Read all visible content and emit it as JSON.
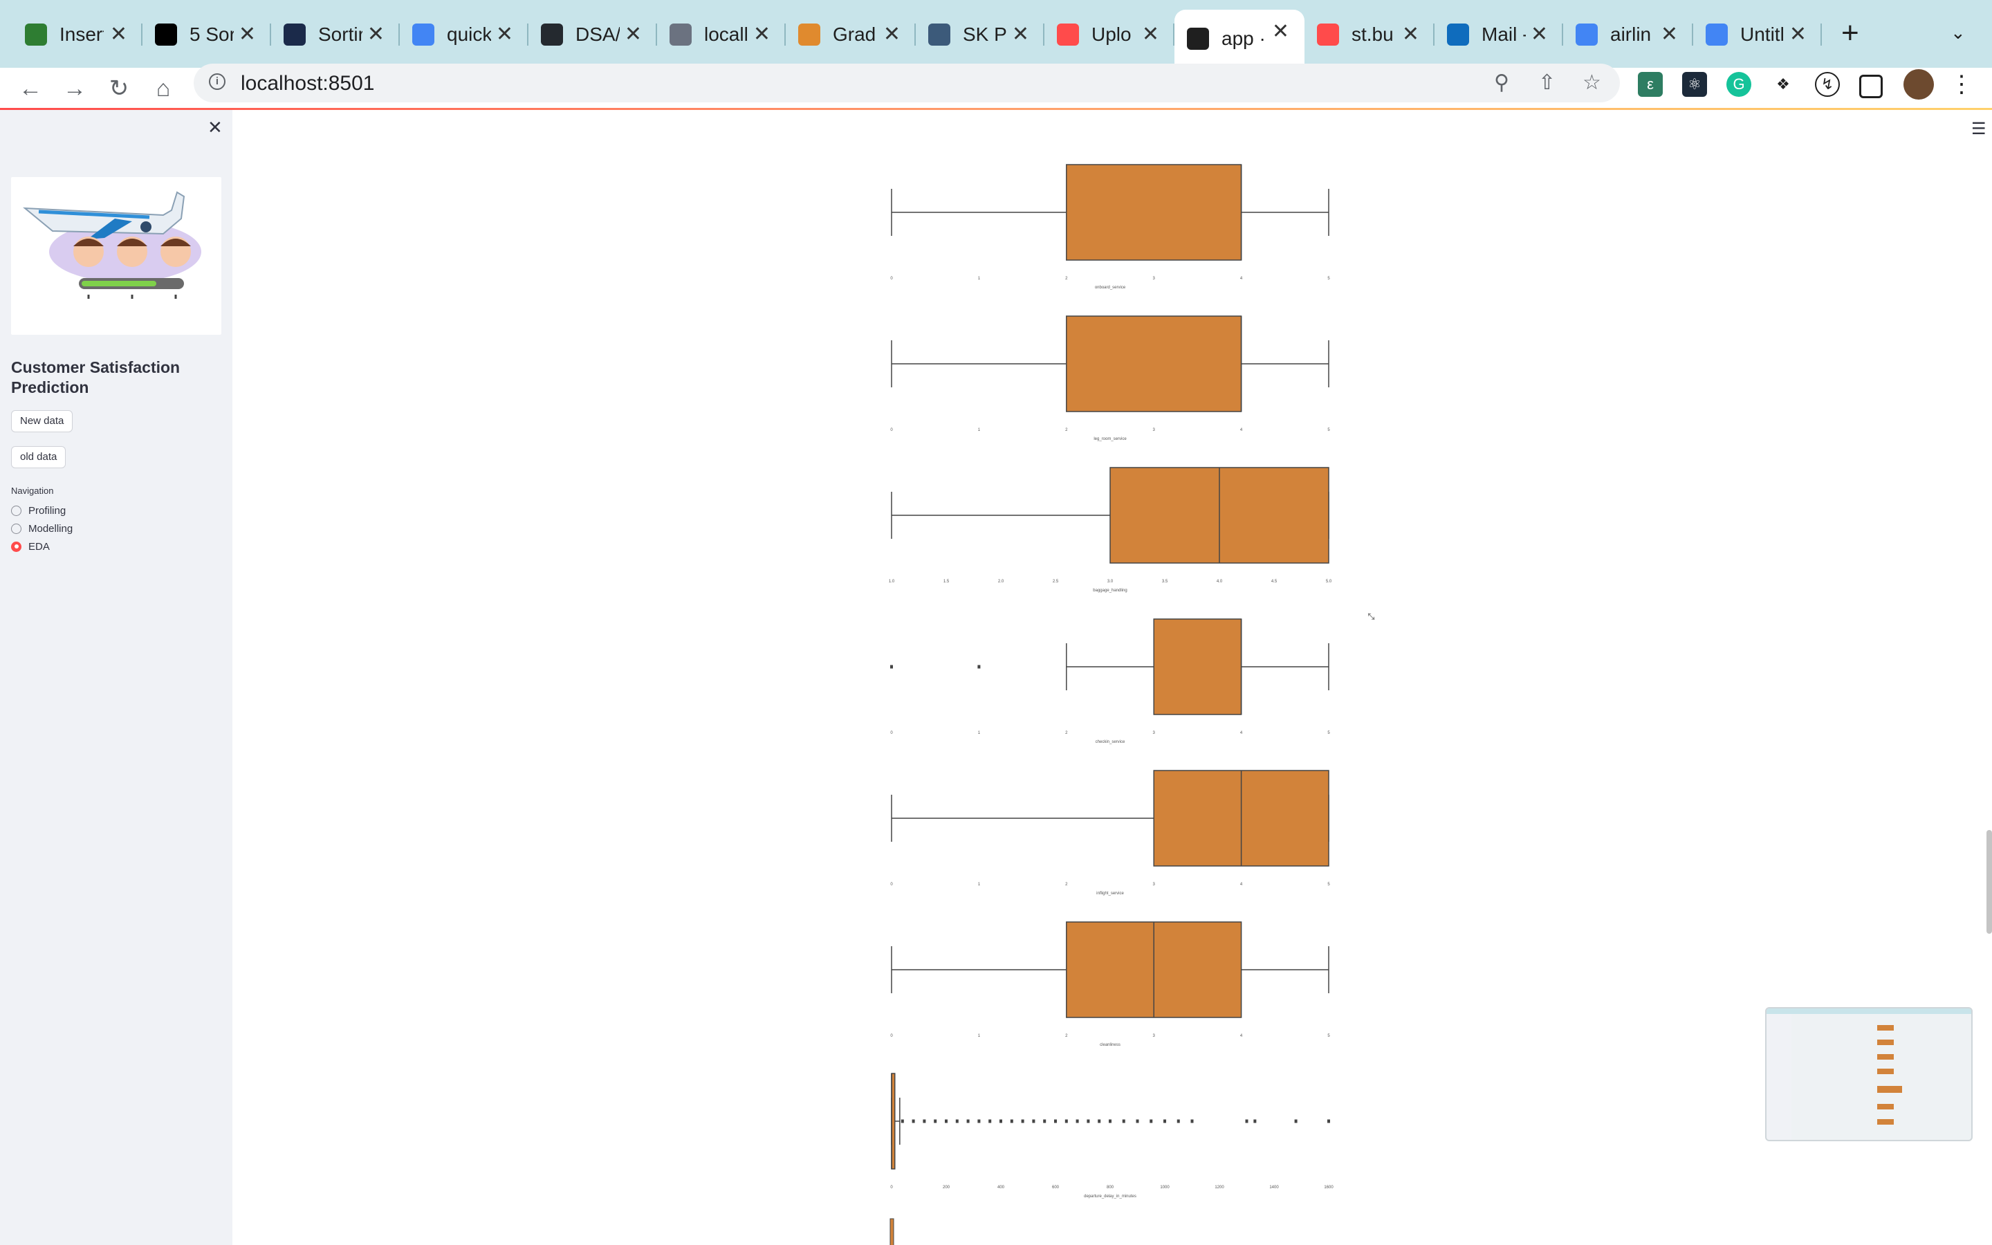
{
  "browser": {
    "tabs": [
      {
        "label": "Insert",
        "color": "#2e7d32",
        "icon": "tab-favicon-leaf"
      },
      {
        "label": "5 Sor",
        "color": "#000000",
        "icon": "tab-favicon-medium"
      },
      {
        "label": "Sortir",
        "color": "#1b2a4a",
        "icon": "tab-favicon-leetcode"
      },
      {
        "label": "quick",
        "color": "#4285f4",
        "icon": "tab-favicon-google"
      },
      {
        "label": "DSA/",
        "color": "#24292f",
        "icon": "tab-favicon-github"
      },
      {
        "label": "locall",
        "color": "#6b7280",
        "icon": "tab-favicon-globe"
      },
      {
        "label": "Grad",
        "color": "#e08a2e",
        "icon": "tab-favicon-pencil"
      },
      {
        "label": "SK Pa",
        "color": "#3c5a7a",
        "icon": "tab-favicon-wordpress"
      },
      {
        "label": "Uplo",
        "color": "#ff4b4b",
        "icon": "tab-favicon-streamlit"
      },
      {
        "label": "app ·",
        "color": "#1f1f1f",
        "icon": "tab-favicon-streamlit",
        "active": true
      },
      {
        "label": "st.bu",
        "color": "#ff4b4b",
        "icon": "tab-favicon-streamlit"
      },
      {
        "label": "Mail -",
        "color": "#0f6cbd",
        "icon": "tab-favicon-outlook"
      },
      {
        "label": "airlin",
        "color": "#4285f4",
        "icon": "tab-favicon-google"
      },
      {
        "label": "Untitl",
        "color": "#4285f4",
        "icon": "tab-favicon-docs"
      }
    ],
    "url": "localhost:8501",
    "new_tab_icon": "plus-icon",
    "extension_colors": [
      "#2e7d62",
      "#1c2a3a",
      "#15c39a",
      "#5f6368",
      "#1f1f1f",
      "#1f1f1f"
    ]
  },
  "sidebar": {
    "title": "Customer Satisfaction Prediction",
    "buttons": [
      "New data",
      "old data"
    ],
    "nav_label": "Navigation",
    "nav_options": [
      "Profiling",
      "Modelling",
      "EDA"
    ],
    "nav_selected": "EDA",
    "accent": "#ff4b4b"
  },
  "chart_data": [
    {
      "type": "boxplot",
      "xlabel": "onboard_service",
      "ticks": [
        "0",
        "1",
        "2",
        "3",
        "4",
        "5"
      ],
      "xlim": [
        0,
        5
      ],
      "stats": {
        "min": 0,
        "q1": 2,
        "median": 4,
        "q3": 4,
        "max": 5
      },
      "outliers": []
    },
    {
      "type": "boxplot",
      "xlabel": "leg_room_service",
      "ticks": [
        "0",
        "1",
        "2",
        "3",
        "4",
        "5"
      ],
      "xlim": [
        0,
        5
      ],
      "stats": {
        "min": 0,
        "q1": 2,
        "median": 4,
        "q3": 4,
        "max": 5
      },
      "outliers": []
    },
    {
      "type": "boxplot",
      "xlabel": "baggage_handling",
      "ticks": [
        "1.0",
        "1.5",
        "2.0",
        "2.5",
        "3.0",
        "3.5",
        "4.0",
        "4.5",
        "5.0"
      ],
      "xlim": [
        1,
        5
      ],
      "stats": {
        "min": 1,
        "q1": 3,
        "median": 4,
        "q3": 5,
        "max": 5
      },
      "outliers": []
    },
    {
      "type": "boxplot",
      "xlabel": "checkin_service",
      "ticks": [
        "0",
        "1",
        "2",
        "3",
        "4",
        "5"
      ],
      "xlim": [
        0,
        5
      ],
      "stats": {
        "min": 2,
        "q1": 3,
        "median": 4,
        "q3": 4,
        "max": 5
      },
      "outliers": [
        0,
        1
      ]
    },
    {
      "type": "boxplot",
      "xlabel": "inflight_service",
      "ticks": [
        "0",
        "1",
        "2",
        "3",
        "4",
        "5"
      ],
      "xlim": [
        0,
        5
      ],
      "stats": {
        "min": 0,
        "q1": 3,
        "median": 4,
        "q3": 5,
        "max": 5
      },
      "outliers": []
    },
    {
      "type": "boxplot",
      "xlabel": "cleanliness",
      "ticks": [
        "0",
        "1",
        "2",
        "3",
        "4",
        "5"
      ],
      "xlim": [
        0,
        5
      ],
      "stats": {
        "min": 0,
        "q1": 2,
        "median": 3,
        "q3": 4,
        "max": 5
      },
      "outliers": []
    },
    {
      "type": "boxplot",
      "xlabel": "departure_delay_in_minutes",
      "ticks": [
        "0",
        "200",
        "400",
        "600",
        "800",
        "1000",
        "1200",
        "1400",
        "1600"
      ],
      "xlim": [
        0,
        1600
      ],
      "stats": {
        "min": 0,
        "q1": 0,
        "median": 0,
        "q3": 12,
        "max": 30
      },
      "outliers": [
        40,
        80,
        120,
        160,
        200,
        240,
        280,
        320,
        360,
        400,
        440,
        480,
        520,
        560,
        600,
        640,
        680,
        720,
        760,
        800,
        850,
        900,
        950,
        1000,
        1050,
        1100,
        1300,
        1330,
        1480,
        1600
      ]
    }
  ],
  "box_color": "#d2833a"
}
